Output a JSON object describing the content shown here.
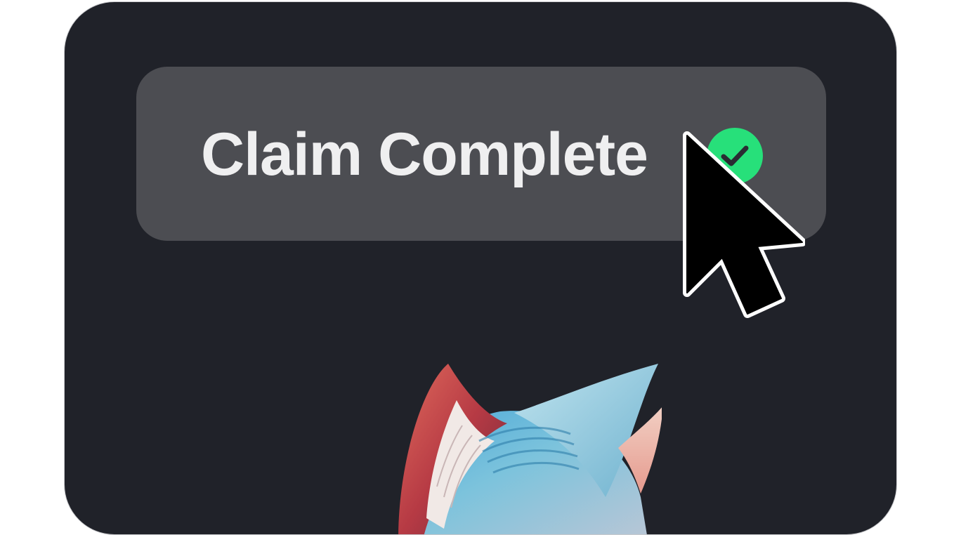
{
  "status": {
    "label": "Claim Complete",
    "icon": "check-circle-icon",
    "icon_color": "#27e07a"
  },
  "artwork": {
    "subject": "cat-head-nft-image"
  },
  "pointer": {
    "icon": "mouse-cursor-icon"
  },
  "colors": {
    "card_background": "#202229",
    "pill_background": "#4c4d52",
    "text": "#efeff0",
    "success": "#27e07a"
  }
}
